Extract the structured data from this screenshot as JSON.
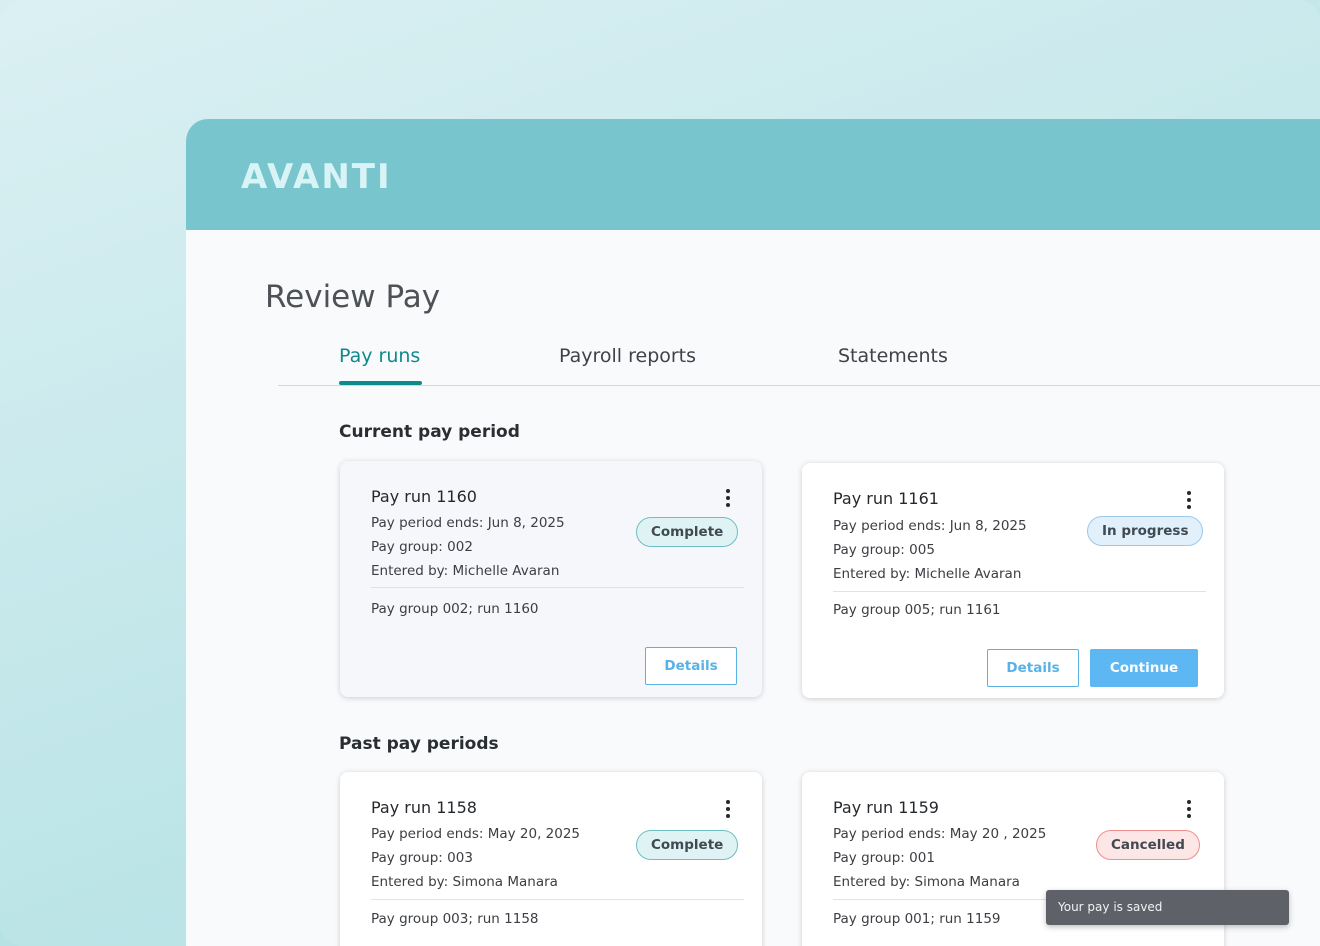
{
  "brand": {
    "logo_text": "AVANTI"
  },
  "page": {
    "title": "Review Pay"
  },
  "tabs": [
    {
      "label": "Pay runs",
      "active": true
    },
    {
      "label": "Payroll reports",
      "active": false
    },
    {
      "label": "Statements",
      "active": false
    }
  ],
  "sections": {
    "current": "Current pay period",
    "past": "Past pay periods"
  },
  "cards": [
    {
      "title": "Pay run 1160",
      "period": "Pay period ends: Jun 8, 2025",
      "group": "Pay group:  002",
      "entered": "Entered by:  Michelle Avaran",
      "status": "Complete",
      "summary": "Pay group 002; run 1160",
      "details_label": "Details"
    },
    {
      "title": "Pay run 1161",
      "period": "Pay period ends: Jun 8, 2025",
      "group": "Pay group:  005",
      "entered": "Entered by:  Michelle Avaran",
      "status": "In progress",
      "summary": "Pay group 005; run 1161",
      "details_label": "Details",
      "continue_label": "Continue"
    },
    {
      "title": "Pay run 1158",
      "period": "Pay period ends: May 20, 2025",
      "group": "Pay group:  003",
      "entered": "Entered by:  Simona Manara",
      "status": "Complete",
      "summary": "Pay group 003; run 1158"
    },
    {
      "title": "Pay run 1159",
      "period": "Pay period ends: May 20 , 2025",
      "group": "Pay group:  001",
      "entered": "Entered by:  Simona Manara",
      "status": "Cancelled",
      "summary": "Pay group 001; run 1159"
    }
  ],
  "toast": {
    "message": "Your pay is saved"
  },
  "colors": {
    "header": "#78c5cd",
    "accent": "#0e8a8f",
    "button": "#5db7f3"
  }
}
